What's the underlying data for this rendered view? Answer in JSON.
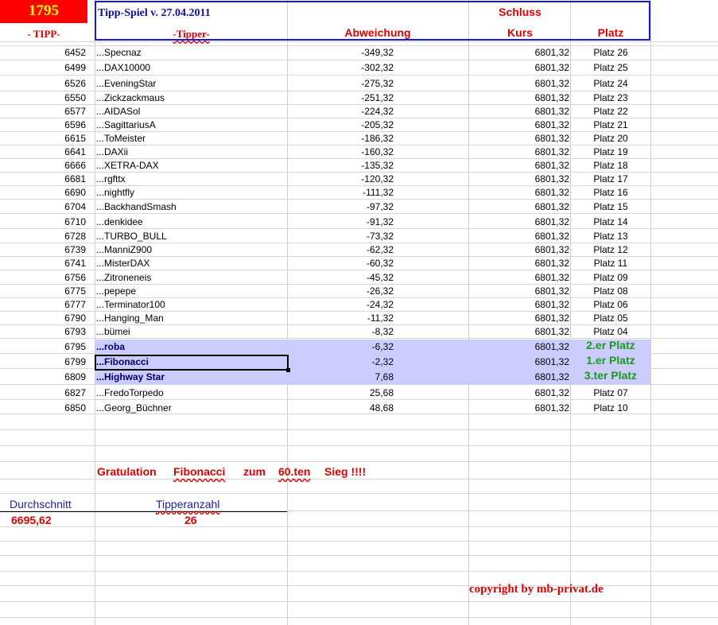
{
  "header": {
    "number": "1795",
    "title": "Tipp-Spiel v. 27.04.2011",
    "schluss": "Schluss",
    "col_tipp": "- TIPP-",
    "col_tipper": "-Tipper-",
    "col_abweichung": "Abweichung",
    "col_kurs": "Kurs",
    "col_platz": "Platz"
  },
  "rows": [
    {
      "tipp": "6452",
      "tipper": "...Specnaz",
      "abw": "-349,32",
      "kurs": "6801,32",
      "platz": "Platz 26"
    },
    {
      "tipp": "6499",
      "tipper": "...DAX10000",
      "abw": "-302,32",
      "kurs": "6801,32",
      "platz": "Platz 25"
    },
    {
      "tipp": "6526",
      "tipper": "...EveningStar",
      "abw": "-275,32",
      "kurs": "6801,32",
      "platz": "Platz 24"
    },
    {
      "tipp": "6550",
      "tipper": "...Zickzackmaus",
      "abw": "-251,32",
      "kurs": "6801,32",
      "platz": "Platz 23"
    },
    {
      "tipp": "6577",
      "tipper": "...AIDASol",
      "abw": "-224,32",
      "kurs": "6801,32",
      "platz": "Platz 22"
    },
    {
      "tipp": "6596",
      "tipper": "...SagittariusA",
      "abw": "-205,32",
      "kurs": "6801,32",
      "platz": "Platz 21"
    },
    {
      "tipp": "6615",
      "tipper": "...ToMeister",
      "abw": "-186,32",
      "kurs": "6801,32",
      "platz": "Platz 20"
    },
    {
      "tipp": "6641",
      "tipper": "...DAXii",
      "abw": "-160,32",
      "kurs": "6801,32",
      "platz": "Platz 19"
    },
    {
      "tipp": "6666",
      "tipper": "...XETRA-DAX",
      "abw": "-135,32",
      "kurs": "6801,32",
      "platz": "Platz 18"
    },
    {
      "tipp": "6681",
      "tipper": "...rgfttx",
      "abw": "-120,32",
      "kurs": "6801,32",
      "platz": "Platz 17"
    },
    {
      "tipp": "6690",
      "tipper": "...nightfly",
      "abw": "-111,32",
      "kurs": "6801,32",
      "platz": "Platz 16"
    },
    {
      "tipp": "6704",
      "tipper": "...BackhandSmash",
      "abw": "-97,32",
      "kurs": "6801,32",
      "platz": "Platz 15"
    },
    {
      "tipp": "6710",
      "tipper": "...denkidee",
      "abw": "-91,32",
      "kurs": "6801,32",
      "platz": "Platz 14"
    },
    {
      "tipp": "6728",
      "tipper": "...TURBO_BULL",
      "abw": "-73,32",
      "kurs": "6801,32",
      "platz": "Platz 13"
    },
    {
      "tipp": "6739",
      "tipper": "...ManniZ900",
      "abw": "-62,32",
      "kurs": "6801,32",
      "platz": "Platz 12"
    },
    {
      "tipp": "6741",
      "tipper": "...MisterDAX",
      "abw": "-60,32",
      "kurs": "6801,32",
      "platz": "Platz 11"
    },
    {
      "tipp": "6756",
      "tipper": "...Zitroneneis",
      "abw": "-45,32",
      "kurs": "6801,32",
      "platz": "Platz 09"
    },
    {
      "tipp": "6775",
      "tipper": "...pepepe",
      "abw": "-26,32",
      "kurs": "6801,32",
      "platz": "Platz 08"
    },
    {
      "tipp": "6777",
      "tipper": "...Terminator100",
      "abw": "-24,32",
      "kurs": "6801,32",
      "platz": "Platz 06"
    },
    {
      "tipp": "6790",
      "tipper": "...Hanging_Man",
      "abw": "-11,32",
      "kurs": "6801,32",
      "platz": "Platz 05"
    },
    {
      "tipp": "6793",
      "tipper": "...bümei",
      "abw": "-8,32",
      "kurs": "6801,32",
      "platz": "Platz 04"
    }
  ],
  "winners": [
    {
      "tipp": "6795",
      "tipper": "...roba",
      "abw": "-6,32",
      "kurs": "6801,32",
      "platz": "2.er Platz"
    },
    {
      "tipp": "6799",
      "tipper": "...Fibonacci",
      "abw": "-2,32",
      "kurs": "6801,32",
      "platz": "1.er Platz"
    },
    {
      "tipp": "6809",
      "tipper": "...Highway Star",
      "abw": "7,68",
      "kurs": "6801,32",
      "platz": "3.ter Platz"
    }
  ],
  "tail_rows": [
    {
      "tipp": "6827",
      "tipper": "...FredoTorpedo",
      "abw": "25,68",
      "kurs": "6801,32",
      "platz": "Platz 07"
    },
    {
      "tipp": "6850",
      "tipper": "...Georg_Büchner",
      "abw": "48,68",
      "kurs": "6801,32",
      "platz": "Platz 10"
    }
  ],
  "congrats": {
    "w1": "Gratulation",
    "w2": "Fibonacci",
    "w3": "zum",
    "w4": "60.ten",
    "w5": "Sieg !!!!"
  },
  "stats": {
    "durchschnitt_label": "Durchschnitt",
    "durchschnitt_value": "6695,62",
    "tipperanzahl_label": "Tipperanzahl",
    "tipperanzahl_value": "26"
  },
  "copyright": "copyright by mb-privat.de",
  "colors": {
    "header_red": "#ff0000",
    "number_yellow": "#ffff00",
    "text_red": "#e00000",
    "border_blue": "#1a1adf",
    "highlight": "#ccccff",
    "green": "#1a9a1a"
  }
}
